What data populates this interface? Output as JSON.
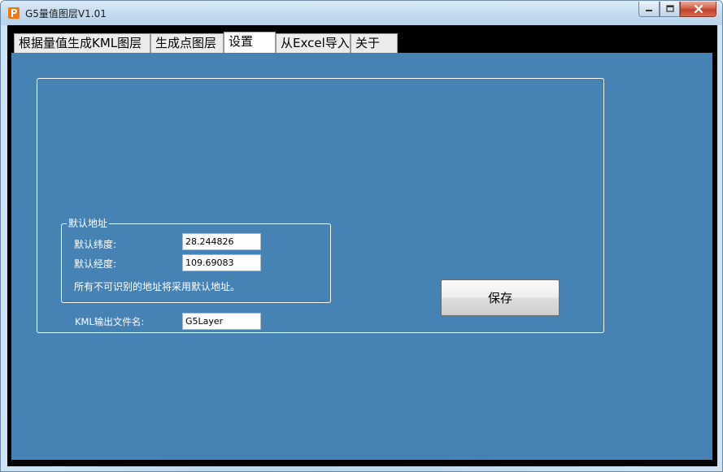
{
  "window": {
    "title": "G5量值图层V1.01",
    "app_icon": "p-logo-icon",
    "controls": [
      "minimize-icon",
      "maximize-icon",
      "close-icon"
    ]
  },
  "tabs": [
    {
      "label": "根据量值生成KML图层",
      "active": false
    },
    {
      "label": "生成点图层",
      "active": false
    },
    {
      "label": "设置",
      "active": true
    },
    {
      "label": "从Excel导入",
      "active": false
    },
    {
      "label": "关于",
      "active": false
    }
  ],
  "settings": {
    "default_group": {
      "title": "默认地址",
      "latitude_label": "默认纬度:",
      "latitude_value": "28.244826",
      "longitude_label": "默认经度:",
      "longitude_value": "109.69083",
      "note": "所有不可识别的地址将采用默认地址。"
    },
    "kml_output": {
      "label": "KML输出文件名:",
      "value": "G5Layer"
    },
    "save_label": "保存"
  },
  "colors": {
    "panel_bg": "#4682b4",
    "client_bg": "#000000",
    "text_on_panel": "#ffffff"
  }
}
